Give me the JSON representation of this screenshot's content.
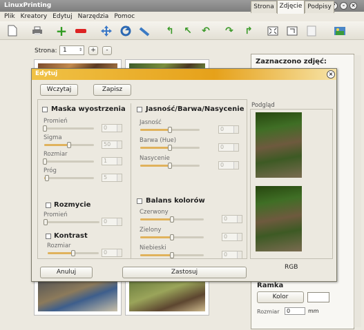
{
  "window": {
    "title": "LinuxPrinting",
    "controls": [
      "?",
      "–",
      "×"
    ]
  },
  "menu": [
    "Plik",
    "Kreatory",
    "Edytuj",
    "Narzędzia",
    "Pomoc"
  ],
  "toolbar": {
    "icons": [
      "new-page-icon",
      "print-icon",
      "add-icon",
      "remove-icon",
      "move-icon",
      "rotate-icon",
      "flip-icon",
      "arrow-left-icon",
      "arrow-up-left-icon",
      "arrow-back-icon",
      "arrow-right-icon",
      "arrow-forward-icon",
      "fit-icon",
      "export-icon",
      "blank-icon",
      "settings-icon"
    ]
  },
  "pager": {
    "label": "Strona:",
    "value": "1",
    "plus": "+",
    "minus": "-"
  },
  "right_panel": {
    "tabs": [
      "Strona",
      "Zdjęcie",
      "Podpisy"
    ],
    "active_tab": "Zdjęcie",
    "heading": "Zaznaczono zdjęć:",
    "frame_label": "Ramka",
    "color_button": "Kolor",
    "size_label": "Rozmiar",
    "size_value": "0",
    "size_unit": "mm"
  },
  "dialog": {
    "title": "Edytuj",
    "load_button": "Wczytaj",
    "save_button": "Zapisz",
    "sharpen": {
      "title": "Maska wyostrzenia",
      "params": [
        {
          "label": "Promień",
          "value": "0",
          "level": 0.02
        },
        {
          "label": "Sigma",
          "value": "50",
          "level": 0.5
        },
        {
          "label": "Rozmiar",
          "value": "1",
          "level": 0.02
        },
        {
          "label": "Próg",
          "value": "5",
          "level": 0.05
        }
      ]
    },
    "blur": {
      "title": "Rozmycie",
      "params": [
        {
          "label": "Promień",
          "value": "0",
          "level": 0.02
        }
      ]
    },
    "contrast": {
      "title": "Kontrast",
      "params": [
        {
          "label": "Rozmiar",
          "value": "0",
          "level": 0.5
        }
      ]
    },
    "hsb": {
      "title": "Jasność/Barwa/Nasycenie",
      "params": [
        {
          "label": "Jasność",
          "value": "0",
          "level": 0.5
        },
        {
          "label": "Barwa (Hue)",
          "value": "0",
          "level": 0.5
        },
        {
          "label": "Nasycenie",
          "value": "0",
          "level": 0.5
        }
      ]
    },
    "color_balance": {
      "title": "Balans kolorów",
      "params": [
        {
          "label": "Czerwony",
          "value": "0",
          "level": 0.5
        },
        {
          "label": "Zielony",
          "value": "0",
          "level": 0.5
        },
        {
          "label": "Niebieski",
          "value": "0",
          "level": 0.5
        }
      ]
    },
    "preview_label": "Podgląd",
    "preview_mode": "RGB",
    "cancel_button": "Anuluj",
    "apply_button": "Zastosuj"
  }
}
